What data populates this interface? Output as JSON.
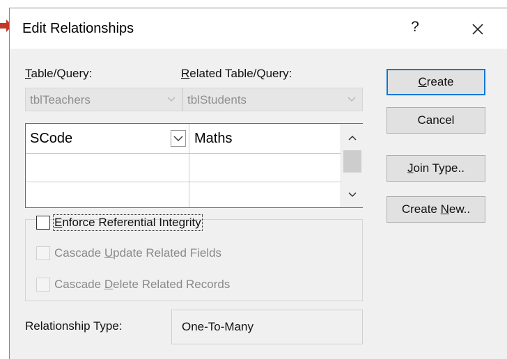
{
  "window": {
    "title": "Edit Relationships",
    "help_glyph": "?",
    "close_glyph": "×"
  },
  "labels": {
    "table_query_pre": "",
    "table_query_u": "T",
    "table_query_post": "able/Query:",
    "related_pre": "",
    "related_u": "R",
    "related_post": "elated Table/Query:"
  },
  "combos": {
    "table": "tblTeachers",
    "related": "tblStudents"
  },
  "grid": {
    "rows": [
      {
        "left": "SCode",
        "right": "Maths"
      },
      {
        "left": "",
        "right": ""
      },
      {
        "left": "",
        "right": ""
      }
    ]
  },
  "options": {
    "enforce_pre": "",
    "enforce_u": "E",
    "enforce_post": "nforce Referential Integrity",
    "enforce_checked": false,
    "cascade_update_pre": "Cascade ",
    "cascade_update_u": "U",
    "cascade_update_post": "pdate Related Fields",
    "cascade_delete_pre": "Cascade ",
    "cascade_delete_u": "D",
    "cascade_delete_post": "elete Related Records"
  },
  "relationship": {
    "label": "Relationship Type:",
    "value": "One-To-Many"
  },
  "buttons": {
    "create_u": "C",
    "create_post": "reate",
    "cancel": "Cancel",
    "join_u": "J",
    "join_post": "oin Type..",
    "create_new_pre": "Create ",
    "create_new_u": "N",
    "create_new_post": "ew.."
  },
  "colors": {
    "pointer_arrow": "#c0392b",
    "default_button_border": "#0078d7",
    "dialog_background": "#f0f0f0"
  }
}
